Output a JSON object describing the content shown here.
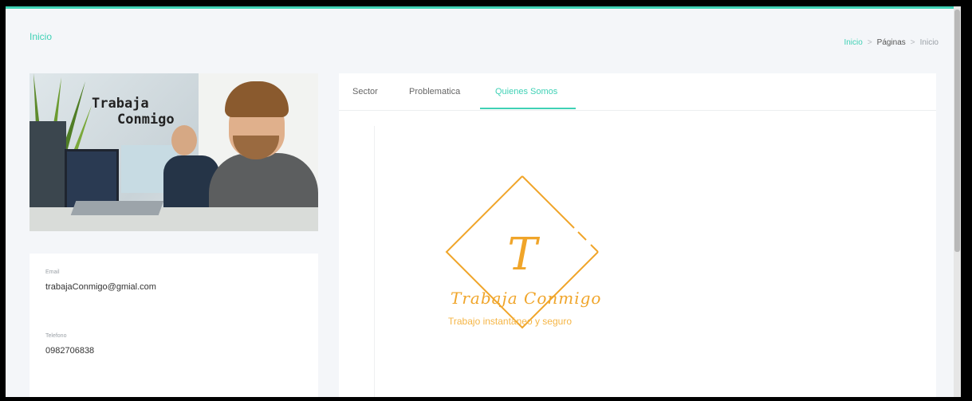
{
  "header": {
    "title": "Inicio",
    "breadcrumb": [
      "Inicio",
      "Páginas",
      "Inicio"
    ],
    "separator": ">"
  },
  "banner": {
    "line1": "Trabaja",
    "line2": "Conmigo"
  },
  "contact": {
    "email_label": "Email",
    "email": "trabajaConmigo@gmial.com",
    "phone_label": "Telefono",
    "phone": "0982706838"
  },
  "tabs": [
    "Sector",
    "Problematica",
    "Quienes Somos"
  ],
  "active_tab": "Quienes Somos",
  "logo": {
    "letter": "T",
    "name": "Trabaja Conmigo",
    "tagline": "Trabajo instantáneo y seguro"
  },
  "colors": {
    "accent": "#3fd1b5",
    "logo": "#f0a52a",
    "background": "#f4f6f9"
  }
}
